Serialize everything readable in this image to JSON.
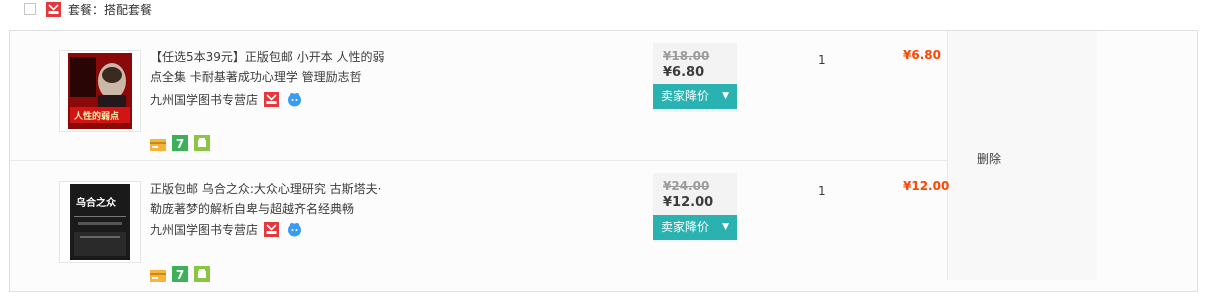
{
  "header": {
    "package_label": "套餐：搭配套餐"
  },
  "items": [
    {
      "cover_text": "人性的弱点",
      "title": "【任选5本39元】正版包邮 小开本 人性的弱点全集 卡耐基著成功心理学 管理励志哲",
      "shop": "九州国学图书专营店",
      "original_price": "¥18.00",
      "price": "¥6.80",
      "seller_button": "卖家降价",
      "quantity": "1",
      "subtotal": "¥6.80"
    },
    {
      "cover_text": "乌合之众",
      "title": "正版包邮 乌合之众:大众心理研究 古斯塔夫·勒庞著梦的解析自卑与超越齐名经典畅",
      "shop": "九州国学图书专营店",
      "original_price": "¥24.00",
      "price": "¥12.00",
      "seller_button": "卖家降价",
      "quantity": "1",
      "subtotal": "¥12.00"
    }
  ],
  "actions": {
    "delete": "删除"
  },
  "service_icons": [
    "credit-card-icon",
    "seven-day-return-icon",
    "android-icon"
  ],
  "colors": {
    "accent": "#2ab2b0",
    "price_red": "#ff4400",
    "brand_badge": "#e4393c"
  }
}
